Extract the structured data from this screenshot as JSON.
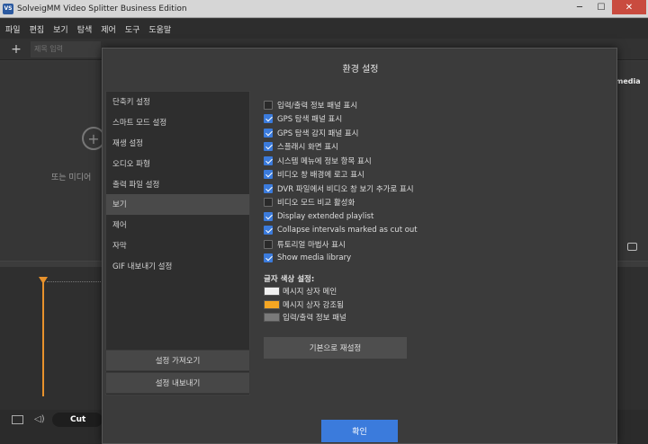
{
  "window": {
    "title": "SolveigMM Video Splitter Business Edition",
    "icon_text": "VS",
    "minimize": "─",
    "maximize": "☐",
    "close": "✕"
  },
  "menu": [
    "파일",
    "편집",
    "보기",
    "탐색",
    "제어",
    "도구",
    "도움말"
  ],
  "tabs": {
    "add_label": "+",
    "title_placeholder": "제목 입력"
  },
  "main": {
    "add_media_symbol": "+",
    "drop_hint": "또는 미디어",
    "media_label": "media",
    "cut_mode": "Cut"
  },
  "dialog": {
    "title": "환경 설정",
    "nav_items": [
      {
        "label": "단축키 설정",
        "active": false
      },
      {
        "label": "스마트 모드 설정",
        "active": false
      },
      {
        "label": "재생 설정",
        "active": false
      },
      {
        "label": "오디오 파형",
        "active": false
      },
      {
        "label": "출력 파일 설정",
        "active": false
      },
      {
        "label": "보기",
        "active": true
      },
      {
        "label": "제어",
        "active": false
      },
      {
        "label": "자막",
        "active": false
      },
      {
        "label": "GIF 내보내기 설정",
        "active": false
      }
    ],
    "import_button": "설정 가져오기",
    "export_button": "설정 내보내기",
    "options": [
      {
        "label": "입력/출력 정보 패널 표시",
        "checked": false
      },
      {
        "label": "GPS 탐색 패널 표시",
        "checked": true
      },
      {
        "label": "GPS 탐색 감지 패널 표시",
        "checked": true
      },
      {
        "label": "스플래시 화면 표시",
        "checked": true
      },
      {
        "label": "시스템 메뉴에 정보 항목 표시",
        "checked": true
      },
      {
        "label": "비디오 창 배경에 로고 표시",
        "checked": true
      },
      {
        "label": "DVR 파일에서 비디오 창 보기 추가로 표시",
        "checked": true
      },
      {
        "label": "비디오 모드 비교 활성화",
        "checked": false
      },
      {
        "label": "Display extended playlist",
        "checked": true
      },
      {
        "label": "Collapse intervals marked as cut out",
        "checked": true
      },
      {
        "label": "튜토리얼 마법사 표시",
        "checked": false
      },
      {
        "label": "Show media library",
        "checked": true
      }
    ],
    "color_heading": "글자 색상 설정:",
    "colors": [
      {
        "label": "메시지 상자 메인",
        "color": "#f0f0f0"
      },
      {
        "label": "메시지 상자 강조됨",
        "color": "#f5a623"
      },
      {
        "label": "입력/출력 정보 패널",
        "color": "#7a7a7a"
      }
    ],
    "reset_button": "기본으로 재설정",
    "ok_button": "확인",
    "accent_color": "#3b7bdc"
  }
}
